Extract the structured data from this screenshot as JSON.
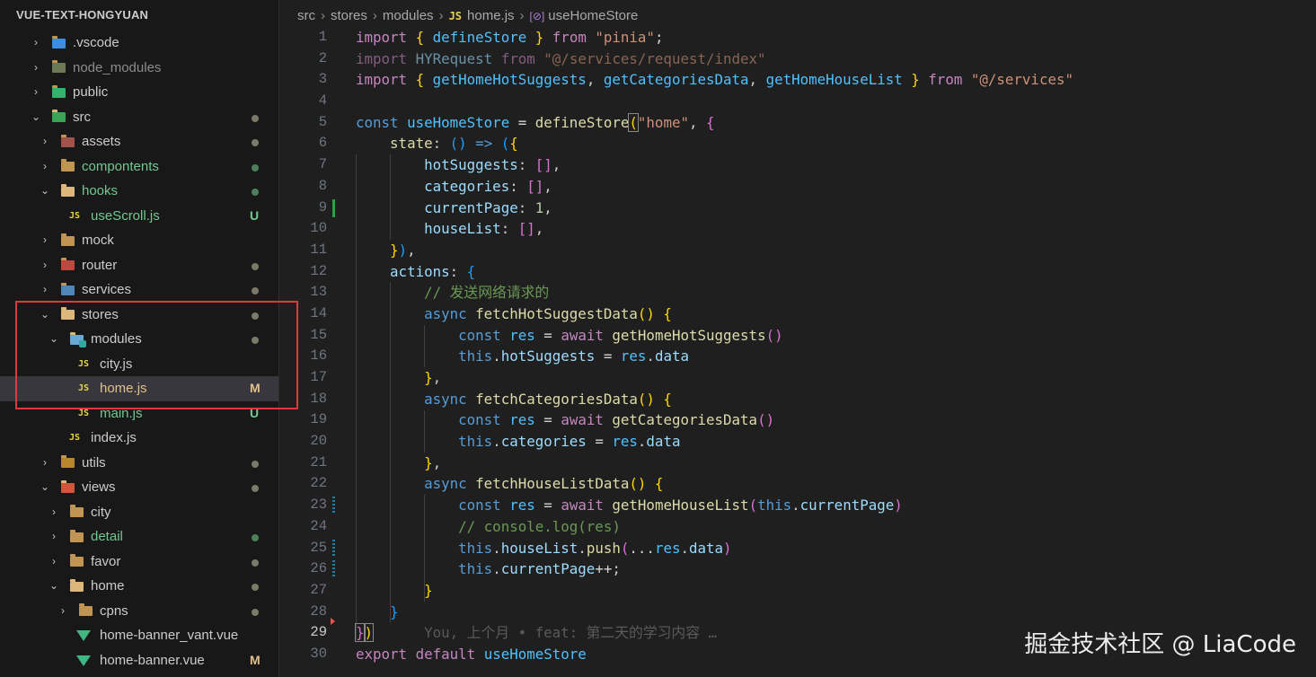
{
  "explorer": {
    "title": "VUE-TEXT-HONGYUAN",
    "items": [
      {
        "label": "vscode_folder",
        "text": ".vscode"
      },
      {
        "text": "node_modules"
      },
      {
        "text": "public"
      },
      {
        "text": "src"
      },
      {
        "text": "assets"
      },
      {
        "text": "compontents"
      },
      {
        "text": "hooks"
      },
      {
        "text": "useScroll.js",
        "badge": "U"
      },
      {
        "text": "mock"
      },
      {
        "text": "router"
      },
      {
        "text": "services"
      },
      {
        "text": "stores"
      },
      {
        "text": "modules"
      },
      {
        "text": "city.js"
      },
      {
        "text": "home.js",
        "badge": "M"
      },
      {
        "text": "main.js",
        "badge": "U"
      },
      {
        "text": "index.js"
      },
      {
        "text": "utils"
      },
      {
        "text": "views"
      },
      {
        "text": "city"
      },
      {
        "text": "detail"
      },
      {
        "text": "favor"
      },
      {
        "text": "home"
      },
      {
        "text": "cpns"
      },
      {
        "text": "home-banner_vant.vue"
      },
      {
        "text": "home-banner.vue",
        "badge": "M"
      }
    ]
  },
  "breadcrumb": {
    "parts": [
      "src",
      "stores",
      "modules"
    ],
    "file_icon": "JS",
    "file": "home.js",
    "symbol_icon": "[⊘]",
    "symbol": "useHomeStore"
  },
  "editor": {
    "line_numbers": [
      "1",
      "2",
      "3",
      "4",
      "5",
      "6",
      "7",
      "8",
      "9",
      "10",
      "11",
      "12",
      "13",
      "14",
      "15",
      "16",
      "17",
      "18",
      "19",
      "20",
      "21",
      "22",
      "23",
      "24",
      "25",
      "26",
      "27",
      "28",
      "29",
      "30"
    ],
    "active_line": 29,
    "blame": "You, 上个月 • feat: 第二天的学习内容 …"
  },
  "colors": {
    "accent": "#e0383e",
    "modified": "#e2c08d",
    "untracked": "#73c991"
  },
  "watermark": "掘金技术社区 @ LiaCode"
}
